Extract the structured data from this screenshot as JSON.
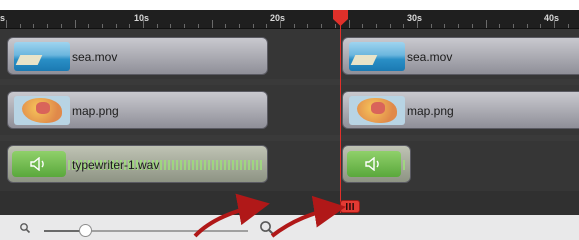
{
  "ruler": {
    "labels": [
      "s",
      "10s",
      "20s",
      "30s",
      "40s"
    ]
  },
  "clips": {
    "sea_left": "sea.mov",
    "map_left": "map.png",
    "audio_left": "typewriter-1.wav",
    "sea_right": "sea.mov",
    "map_right": "map.png"
  },
  "playhead": {
    "time_label": "",
    "color": "#e0302a"
  },
  "zoom": {
    "level": 0.2
  },
  "icons": {
    "zoom_out": "magnifier-small-icon",
    "zoom_in": "magnifier-large-icon",
    "speaker": "speaker-icon",
    "playhead": "playhead-icon",
    "trim": "trim-handle-icon"
  },
  "colors": {
    "accent": "#e0302a",
    "annotation_arrow": "#b01818",
    "audio_green": "#6ebd47"
  }
}
